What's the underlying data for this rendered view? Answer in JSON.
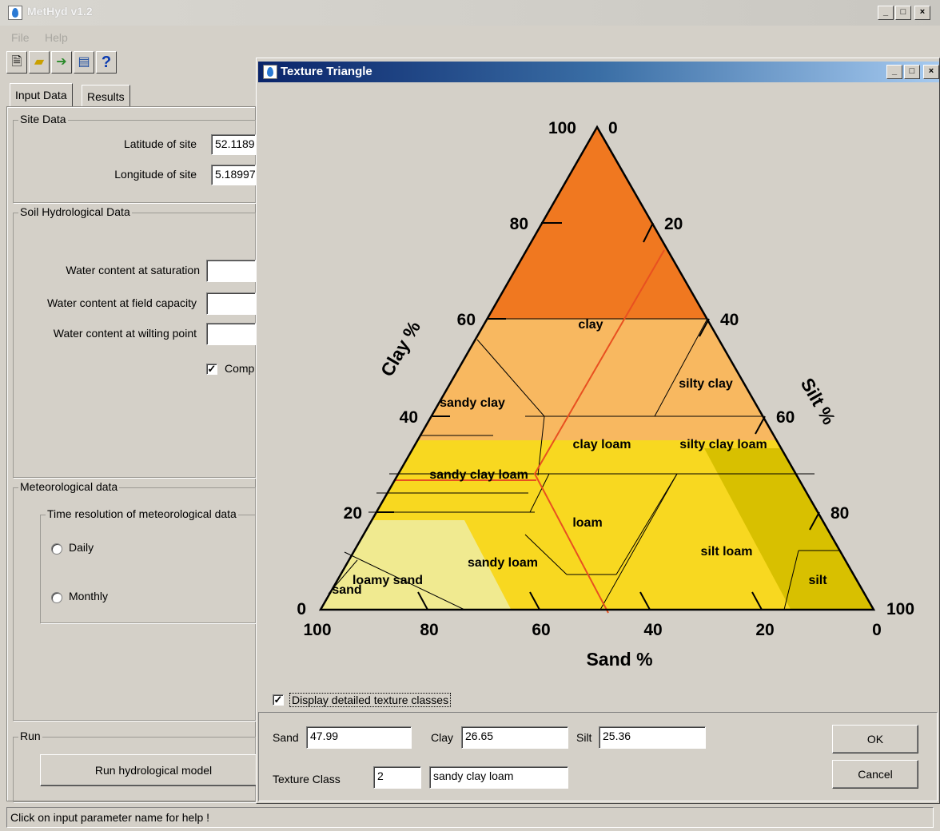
{
  "app": {
    "title": "MetHyd v1.2",
    "menu": [
      "File",
      "Help"
    ],
    "toolbar_icons": [
      "new-file-icon",
      "open-folder-icon",
      "arrow-right-icon",
      "print-icon",
      "help-icon"
    ],
    "tabs": [
      {
        "label": "Input Data",
        "active": true
      },
      {
        "label": "Results",
        "active": false
      }
    ],
    "site_data": {
      "legend": "Site Data",
      "latitude_label": "Latitude of site",
      "latitude_value": "52.1189",
      "longitude_label": "Longitude of site",
      "longitude_value": "5.18997"
    },
    "soil": {
      "legend": "Soil Hydrological Data",
      "saturation_label": "Water content at saturation",
      "field_capacity_label": "Water content at field capacity",
      "wilting_label": "Water content at wilting point",
      "compute_label": "Comp",
      "compute_checked": true
    },
    "meteo": {
      "legend": "Meteorological data",
      "resolution_legend": "Time resolution of meteorological data",
      "daily_label": "Daily",
      "monthly_label": "Monthly"
    },
    "run": {
      "legend": "Run",
      "button_label": "Run hydrological model"
    },
    "status": "Click on input parameter name for help !"
  },
  "dialog": {
    "title": "Texture Triangle",
    "axis_labels": {
      "clay": "Clay %",
      "silt": "Silt %",
      "sand": "Sand %"
    },
    "clay_ticks": [
      "100",
      "80",
      "60",
      "40",
      "20",
      "0"
    ],
    "silt_ticks": [
      "0",
      "20",
      "40",
      "60",
      "80",
      "100"
    ],
    "sand_ticks": [
      "100",
      "80",
      "60",
      "40",
      "20",
      "0"
    ],
    "regions": [
      "clay",
      "silty clay",
      "sandy clay",
      "clay loam",
      "silty clay loam",
      "sandy clay loam",
      "loam",
      "silt loam",
      "sandy loam",
      "loamy sand",
      "sand",
      "silt"
    ],
    "colors": {
      "clay": "#f07820",
      "clay_band": "#f8b860",
      "loam_band": "#f8d820",
      "sand_light": "#f0ea90",
      "silt_dark": "#d8c000",
      "selection_line": "#e85020"
    },
    "detailed_checkbox_label": "Display detailed texture classes",
    "detailed_checked": true,
    "sand_label": "Sand",
    "sand_value": "47.99",
    "clay_label": "Clay",
    "clay_value": "26.65",
    "silt_label": "Silt",
    "silt_value": "25.36",
    "texture_class_label": "Texture Class",
    "texture_class_number": "2",
    "texture_class_name": "sandy clay loam",
    "ok_label": "OK",
    "cancel_label": "Cancel"
  }
}
